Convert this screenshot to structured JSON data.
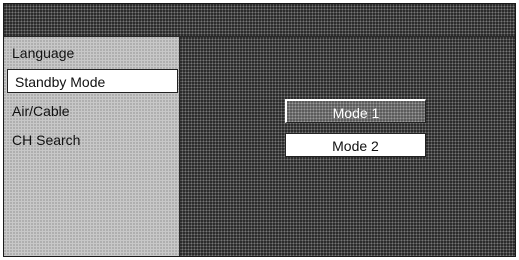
{
  "sidebar": {
    "items": [
      {
        "label": "Language"
      },
      {
        "label": "Standby Mode"
      },
      {
        "label": "Air/Cable"
      },
      {
        "label": "CH Search"
      }
    ]
  },
  "options": {
    "mode1": "Mode 1",
    "mode2": "Mode 2",
    "highlighted": "Mode 1"
  }
}
